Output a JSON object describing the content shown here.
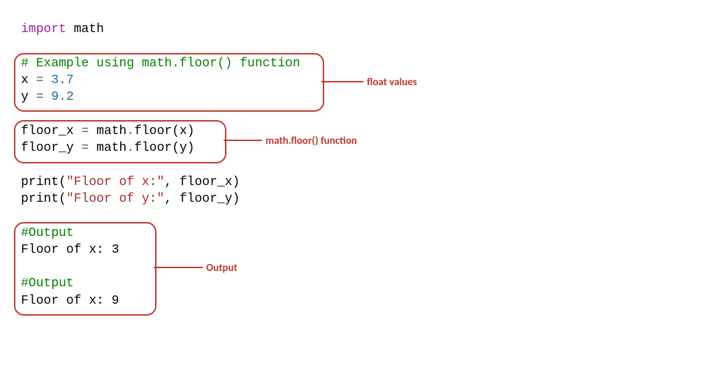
{
  "code": {
    "line1_import": "import",
    "line1_module": " math",
    "blank": " ",
    "comment1": "# Example using math.floor() function",
    "line4_a": "x ",
    "line4_eq": "= ",
    "line4_val": "3.7",
    "line5_a": "y ",
    "line5_eq": "= ",
    "line5_val": "9.2",
    "line7_a": "floor_x ",
    "line7_eq": "= ",
    "line7_b": "math",
    "line7_dot": ".",
    "line7_c": "floor(x)",
    "line8_a": "floor_y ",
    "line8_eq": "= ",
    "line8_b": "math",
    "line8_dot": ".",
    "line8_c": "floor(y)",
    "line10_a": "print",
    "line10_p1": "(",
    "line10_s": "\"Floor of x:\"",
    "line10_rest": ", floor_x)",
    "line11_a": "print",
    "line11_p1": "(",
    "line11_s": "\"Floor of y:\"",
    "line11_rest": ", floor_y)",
    "out_c1": "#Output",
    "out_l1": "Floor of x: 3",
    "out_c2": "#Output",
    "out_l2": "Floor of x: 9"
  },
  "annotations": {
    "callout1": "float values",
    "callout2": "math.floor() function",
    "callout3": "Output"
  }
}
